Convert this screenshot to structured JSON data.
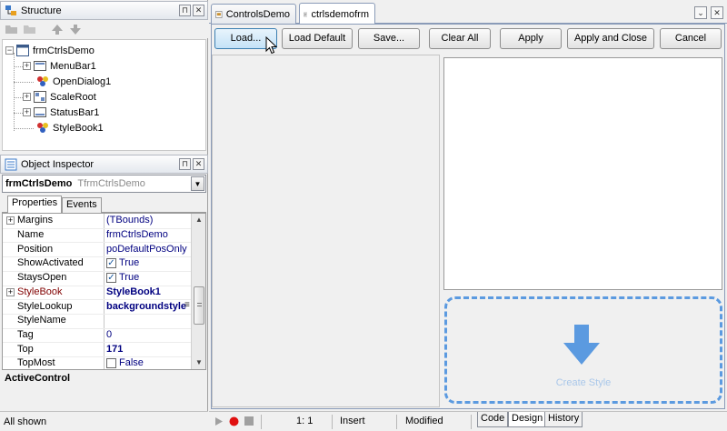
{
  "structure_panel": {
    "title": "Structure",
    "tree": [
      {
        "label": "frmCtrlsDemo",
        "expander": "⊟"
      },
      {
        "label": "MenuBar1",
        "expander": "⊞"
      },
      {
        "label": "OpenDialog1",
        "expander": ""
      },
      {
        "label": "ScaleRoot",
        "expander": "⊞"
      },
      {
        "label": "StatusBar1",
        "expander": "⊞"
      },
      {
        "label": "StyleBook1",
        "expander": ""
      }
    ]
  },
  "object_inspector": {
    "title": "Object Inspector",
    "selected_name": "frmCtrlsDemo",
    "selected_type": "TfrmCtrlsDemo",
    "tabs": [
      "Properties",
      "Events"
    ],
    "properties": [
      {
        "name": "Margins",
        "value": "(TBounds)",
        "expandable": true
      },
      {
        "name": "Name",
        "value": "frmCtrlsDemo"
      },
      {
        "name": "Position",
        "value": "poDefaultPosOnly"
      },
      {
        "name": "ShowActivated",
        "value": "True",
        "checkbox": true
      },
      {
        "name": "StaysOpen",
        "value": "True",
        "checkbox": true
      },
      {
        "name": "StyleBook",
        "value": "StyleBook1",
        "expandable": true,
        "highlight": true
      },
      {
        "name": "StyleLookup",
        "value": "backgroundstyle"
      },
      {
        "name": "StyleName",
        "value": ""
      },
      {
        "name": "Tag",
        "value": "0"
      },
      {
        "name": "Top",
        "value": "171"
      },
      {
        "name": "TopMost",
        "value": "False",
        "checkbox": true,
        "unchecked": true
      }
    ],
    "description": "ActiveControl",
    "status": "All shown"
  },
  "editor": {
    "tabs": [
      "ControlsDemo",
      "ctrlsdemofrm"
    ],
    "active_tab": "ctrlsdemofrm",
    "buttons": {
      "load": "Load...",
      "load_default": "Load Default",
      "save": "Save...",
      "clear_all": "Clear All",
      "apply": "Apply",
      "apply_close": "Apply and Close",
      "cancel": "Cancel"
    },
    "create_style_label": "Create Style",
    "status": {
      "position": "1:   1",
      "mode": "Insert",
      "modified": "Modified"
    },
    "bottom_tabs": [
      "Code",
      "Design",
      "History"
    ]
  },
  "colors": {
    "accent_blue": "#5b9ae0",
    "prop_value": "#000080",
    "highlight_name": "#800000"
  }
}
